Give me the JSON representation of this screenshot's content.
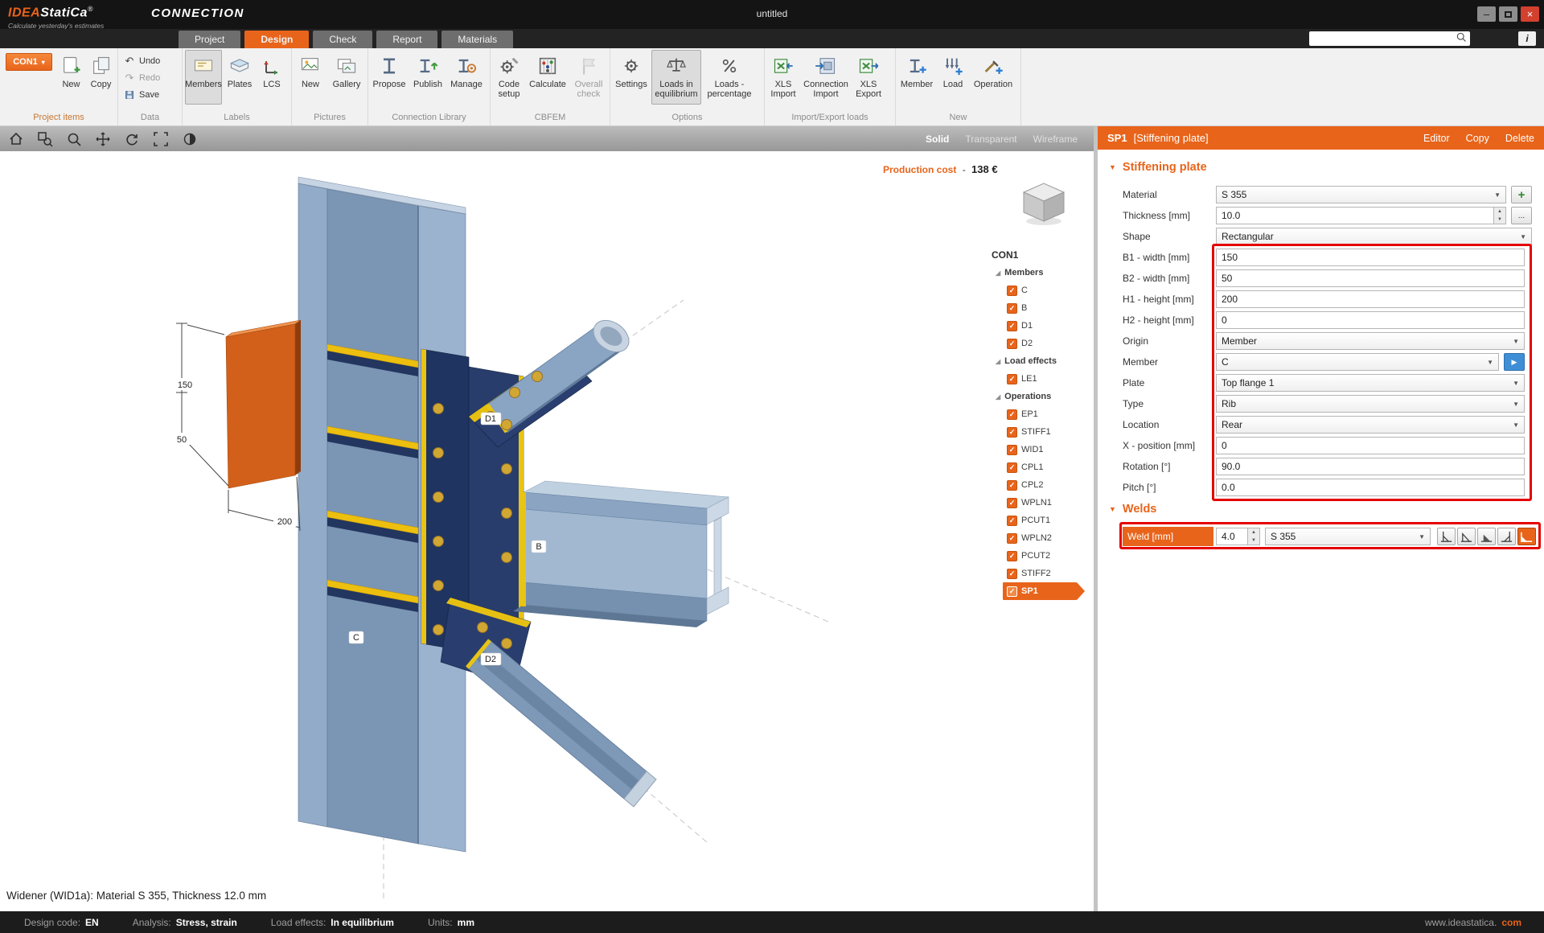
{
  "titlebar": {
    "logo_primary": "IDEA",
    "logo_secondary": "StatiCa",
    "logo_reg": "®",
    "product": "CONNECTION",
    "tagline": "Calculate yesterday's estimates",
    "document_title": "untitled"
  },
  "tabs": {
    "project": "Project",
    "design": "Design",
    "check": "Check",
    "report": "Report",
    "materials": "Materials"
  },
  "ribbon": {
    "project_items": {
      "group": "Project items",
      "con_selector": "CON1",
      "new": "New",
      "copy": "Copy"
    },
    "data": {
      "group": "Data",
      "undo": "Undo",
      "redo": "Redo",
      "save": "Save"
    },
    "labels": {
      "group": "Labels",
      "members": "Members",
      "plates": "Plates",
      "lcs": "LCS"
    },
    "pictures": {
      "group": "Pictures",
      "new": "New",
      "gallery": "Gallery"
    },
    "connection_library": {
      "group": "Connection Library",
      "propose": "Propose",
      "publish": "Publish",
      "manage": "Manage"
    },
    "cbfem": {
      "group": "CBFEM",
      "code_setup": "Code setup",
      "calculate": "Calculate",
      "overall_check": "Overall check"
    },
    "options": {
      "group": "Options",
      "settings": "Settings",
      "loads_in_equilibrium": "Loads in equilibrium",
      "loads_percentage": "Loads - percentage"
    },
    "import_export": {
      "group": "Import/Export loads",
      "xls_import": "XLS Import",
      "connection_import": "Connection Import",
      "xls_export": "XLS Export"
    },
    "new": {
      "group": "New",
      "member": "Member",
      "load": "Load",
      "operation": "Operation"
    }
  },
  "viewport": {
    "display_modes": {
      "solid": "Solid",
      "transparent": "Transparent",
      "wireframe": "Wireframe"
    },
    "production_cost": {
      "label": "Production cost",
      "separator": "-",
      "value": "138 €"
    },
    "dimensions": {
      "b1": "150",
      "b2": "50",
      "h1": "200"
    },
    "labels": {
      "d1": "D1",
      "b": "B",
      "c": "C",
      "d2": "D2"
    },
    "hover_info": "Widener (WID1a): Material S 355, Thickness 12.0 mm"
  },
  "tree": {
    "root": "CON1",
    "members": {
      "label": "Members",
      "items": [
        "C",
        "B",
        "D1",
        "D2"
      ]
    },
    "load_effects": {
      "label": "Load effects",
      "items": [
        "LE1"
      ]
    },
    "operations": {
      "label": "Operations",
      "items": [
        "EP1",
        "STIFF1",
        "WID1",
        "CPL1",
        "CPL2",
        "WPLN1",
        "PCUT1",
        "WPLN2",
        "PCUT2",
        "STIFF2"
      ],
      "selected": "SP1"
    }
  },
  "properties": {
    "header": {
      "code": "SP1",
      "type": "[Stiffening plate]",
      "editor": "Editor",
      "copy": "Copy",
      "delete": "Delete"
    },
    "stiffening_plate": {
      "section": "Stiffening plate",
      "material": {
        "label": "Material",
        "value": "S 355"
      },
      "thickness": {
        "label": "Thickness [mm]",
        "value": "10.0"
      },
      "shape": {
        "label": "Shape",
        "value": "Rectangular"
      },
      "b1": {
        "label": "B1 - width [mm]",
        "value": "150"
      },
      "b2": {
        "label": "B2 - width [mm]",
        "value": "50"
      },
      "h1": {
        "label": "H1 - height [mm]",
        "value": "200"
      },
      "h2": {
        "label": "H2 - height [mm]",
        "value": "0"
      },
      "origin": {
        "label": "Origin",
        "value": "Member"
      },
      "member": {
        "label": "Member",
        "value": "C"
      },
      "plate": {
        "label": "Plate",
        "value": "Top flange 1"
      },
      "type": {
        "label": "Type",
        "value": "Rib"
      },
      "location": {
        "label": "Location",
        "value": "Rear"
      },
      "x_position": {
        "label": "X - position [mm]",
        "value": "0"
      },
      "rotation": {
        "label": "Rotation [°]",
        "value": "90.0"
      },
      "pitch": {
        "label": "Pitch [°]",
        "value": "0.0"
      }
    },
    "welds": {
      "section": "Welds",
      "weld": {
        "label": "Weld [mm]",
        "value": "4.0",
        "material": "S 355"
      }
    }
  },
  "statusbar": {
    "design_code": {
      "label": "Design code:",
      "value": "EN"
    },
    "analysis": {
      "label": "Analysis:",
      "value": "Stress, strain"
    },
    "load_effects": {
      "label": "Load effects:",
      "value": "In equilibrium"
    },
    "units": {
      "label": "Units:",
      "value": "mm"
    },
    "website": {
      "prefix": "www.ideastatica.",
      "suffix": "com"
    }
  },
  "colors": {
    "accent": "#e8641b",
    "highlight": "#e50000",
    "plate_orange": "#d2601a",
    "weld_yellow": "#e8c414",
    "steel_blue": "#92abc8",
    "navy_plate": "#203561"
  },
  "icons": {
    "caret": "▼",
    "menu_caret": "▾",
    "plus": "+",
    "check": "✓",
    "up": "▲",
    "down": "▼",
    "dots": "...",
    "expander": "◢",
    "undo": "↶",
    "redo": "↷",
    "minimize": "–",
    "close": "×",
    "info": "i",
    "pick": "▶"
  }
}
